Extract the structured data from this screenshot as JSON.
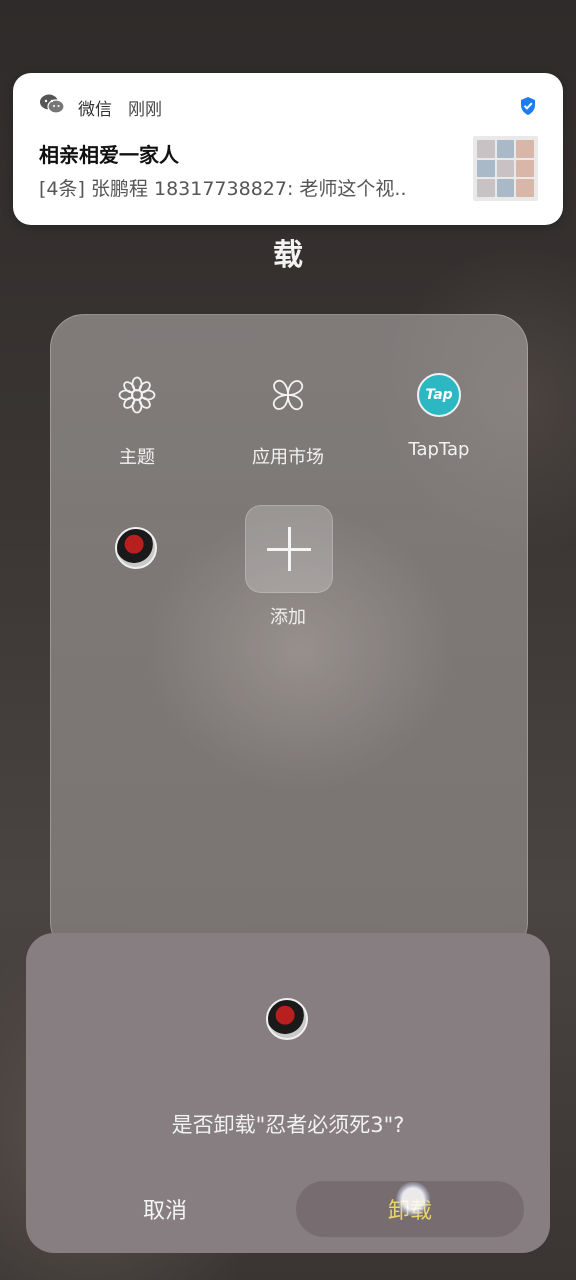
{
  "notification": {
    "app_name": "微信",
    "time": "刚刚",
    "title": "相亲相爱一家人",
    "body": "[4条] 张鹏程 18317738827: 老师这个视..",
    "app_icon": "wechat-icon",
    "check_icon": "verified-shield-icon"
  },
  "background": {
    "partial_title": "载"
  },
  "folder": {
    "apps": [
      {
        "label": "主题",
        "icon": "theme-flower-icon"
      },
      {
        "label": "应用市场",
        "icon": "app-market-clover-icon"
      },
      {
        "label": "TapTap",
        "icon": "taptap-icon",
        "icon_text": "Tap"
      },
      {
        "label": "",
        "icon": "ninja-game-icon"
      }
    ],
    "add_label": "添加"
  },
  "dialog": {
    "icon": "ninja-game-icon",
    "message": "是否卸载\"忍者必须死3\"?",
    "cancel_label": "取消",
    "confirm_label": "卸载"
  },
  "colors": {
    "confirm_text": "#e8d66a",
    "dialog_bg": "#877e82",
    "taptap_brand": "#2bb8c2"
  }
}
